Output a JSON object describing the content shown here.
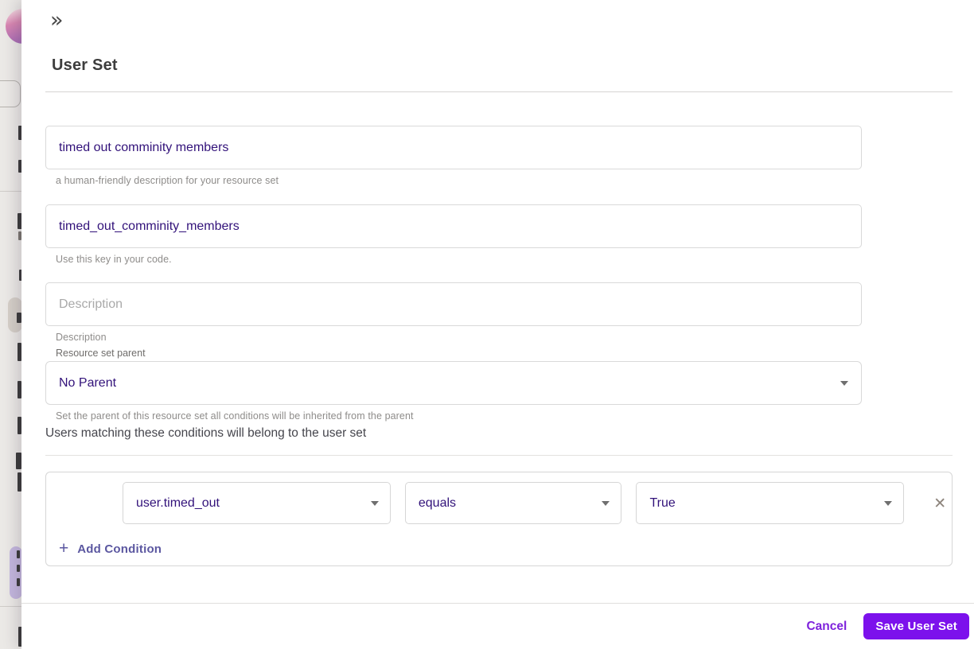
{
  "drawer": {
    "collapse_icon": "»",
    "title": "User Set",
    "name_field": {
      "value": "timed out comminity members",
      "helper": "a human-friendly description for your resource set"
    },
    "key_field": {
      "value": "timed_out_comminity_members",
      "helper": "Use this key in your code."
    },
    "description_field": {
      "placeholder": "Description",
      "helper": "Description"
    },
    "parent_field": {
      "label": "Resource set parent",
      "value": "No Parent",
      "helper": "Set the parent of this resource set all conditions will be inherited from the parent"
    },
    "conditions": {
      "intro": "Users matching these conditions will belong to the user set",
      "rows": [
        {
          "field": "user.timed_out",
          "operator": "equals",
          "value": "True"
        }
      ],
      "add_prefix": "+",
      "add_label": "Add Condition",
      "remove_icon": "✕"
    },
    "footer": {
      "cancel_label": "Cancel",
      "save_label": "Save User Set"
    }
  },
  "colors": {
    "accent_purple": "#7c11ec",
    "value_text_purple": "#32127a",
    "add_condition_purple": "#5b57a0",
    "cancel_purple": "#7e22dc"
  }
}
